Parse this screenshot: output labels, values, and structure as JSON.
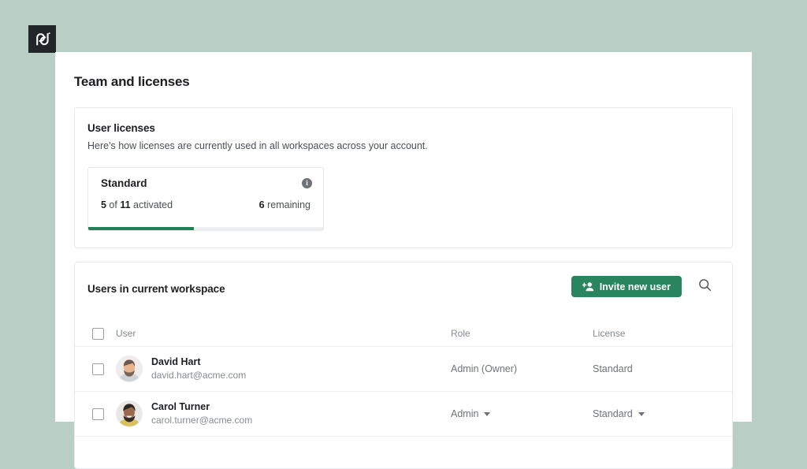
{
  "brand": {
    "logo_icon": "pandadoc-logo",
    "logo_text": "pd"
  },
  "page": {
    "title": "Team and licenses"
  },
  "licenses": {
    "title": "User licenses",
    "subtitle": "Here's how licenses are currently used in all workspaces across your account.",
    "tile": {
      "name": "Standard",
      "info_icon": "info-icon",
      "used_count": "5",
      "used_mid": " of ",
      "total_count": "11",
      "used_suffix": " activated",
      "remaining_count": "6",
      "remaining_suffix": " remaining",
      "progress_percent": 45,
      "progress_color": "#1f8257"
    }
  },
  "users": {
    "title": "Users in current workspace",
    "invite_button": {
      "label": "Invite new user",
      "icon": "person-add-icon",
      "color": "#29855e"
    },
    "search_button": {
      "icon": "search-icon"
    },
    "columns": [
      "User",
      "Role",
      "License"
    ],
    "rows": [
      {
        "name": "David Hart",
        "email": "david.hart@acme.com",
        "avatar_icon": "avatar-david-hart",
        "role": "Admin (Owner)",
        "role_editable": false,
        "license": "Standard",
        "license_editable": false
      },
      {
        "name": "Carol Turner",
        "email": "carol.turner@acme.com",
        "avatar_icon": "avatar-carol-turner",
        "role": "Admin",
        "role_editable": true,
        "license": "Standard",
        "license_editable": true
      }
    ]
  },
  "theme": {
    "background": "#b9cec5",
    "accent": "#29855e",
    "text": "#1c1e21"
  }
}
